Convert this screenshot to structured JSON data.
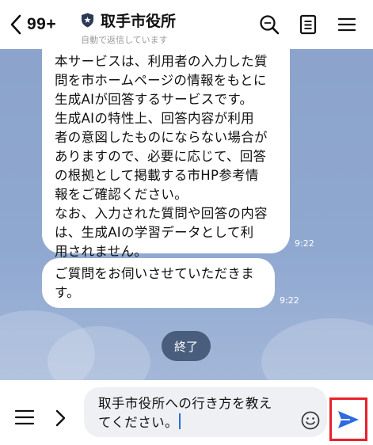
{
  "header": {
    "back_count": "99+",
    "title": "取手市役所",
    "subtitle": "自動で返信しています"
  },
  "messages": [
    {
      "lines": [
        "本サービスは、利用者の入力した質",
        "問を市ホームページの情報をもとに",
        "生成AIが回答するサービスです。",
        "生成AIの特性上、回答内容が利用",
        "者の意図したものにならない場合が",
        "ありますので、必要に応じて、回答",
        "の根拠として掲載する市HP参考情",
        "報をご確認ください。",
        "なお、入力された質問や回答の内容",
        "は、生成AIの学習データとして利",
        "用されません。"
      ],
      "time": "9:22"
    },
    {
      "lines": [
        "ご質問をお伺いさせていただきま",
        "す。"
      ],
      "time": "9:22"
    }
  ],
  "end_button": {
    "label": "終了"
  },
  "composer": {
    "lines": [
      "取手市役所への行き方を教え",
      "てください。"
    ]
  },
  "icons": {
    "back": "chevron-left-icon",
    "official": "shield-star-icon",
    "search": "search-icon",
    "notes": "notes-icon",
    "menu": "hamburger-menu-icon",
    "expand": "chevron-right-icon",
    "emoji": "emoji-icon",
    "send": "send-icon"
  },
  "colors": {
    "chat_background": "#8fa8d0",
    "end_button": "#495d7c",
    "send": "#2f6ae0",
    "highlight_box": "#e8212b"
  }
}
